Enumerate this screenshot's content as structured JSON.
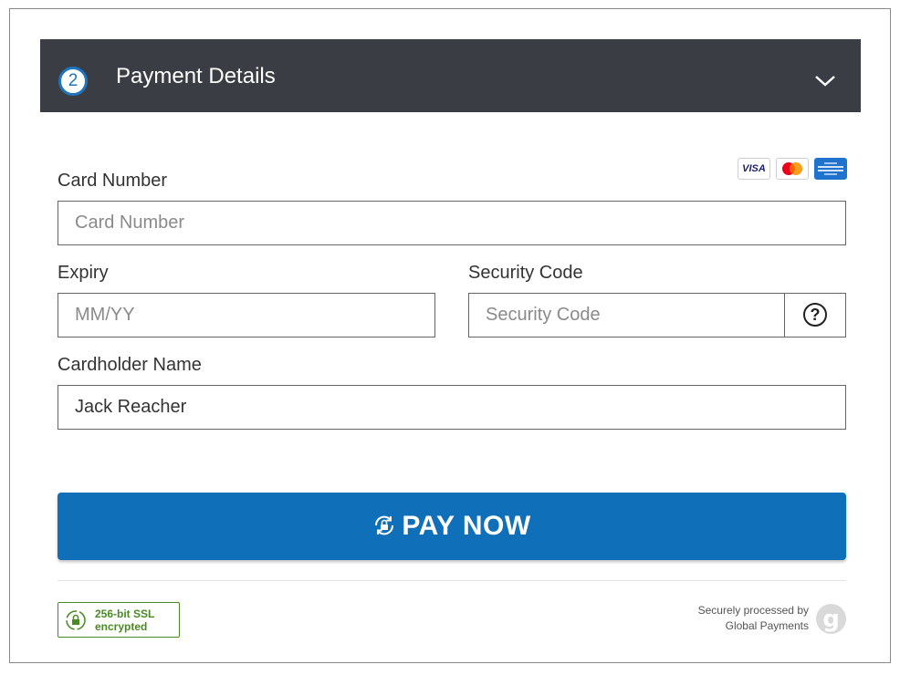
{
  "header": {
    "step_number": "2",
    "title": "Payment Details"
  },
  "card_brands": [
    "visa",
    "mastercard",
    "american-express"
  ],
  "card_brand_text": {
    "visa": "VISA"
  },
  "card_number": {
    "label": "Card Number",
    "placeholder": "Card Number",
    "value": ""
  },
  "expiry": {
    "label": "Expiry",
    "placeholder": "MM/YY",
    "value": ""
  },
  "security_code": {
    "label": "Security Code",
    "placeholder": "Security Code",
    "value": "",
    "help_symbol": "?"
  },
  "cardholder": {
    "label": "Cardholder Name",
    "placeholder": "",
    "value": "Jack Reacher"
  },
  "pay_button": {
    "label": "PAY NOW",
    "icon": "lock-refresh-icon"
  },
  "ssl_badge": {
    "line1": "256-bit SSL",
    "line2": "encrypted",
    "icon": "padlock-icon"
  },
  "processor": {
    "line1": "Securely processed by",
    "line2": "Global Payments",
    "logo_letter": "g"
  },
  "colors": {
    "header_bg": "#3b3d44",
    "accent_blue": "#0f6fb9",
    "ssl_green": "#4a8a23"
  }
}
